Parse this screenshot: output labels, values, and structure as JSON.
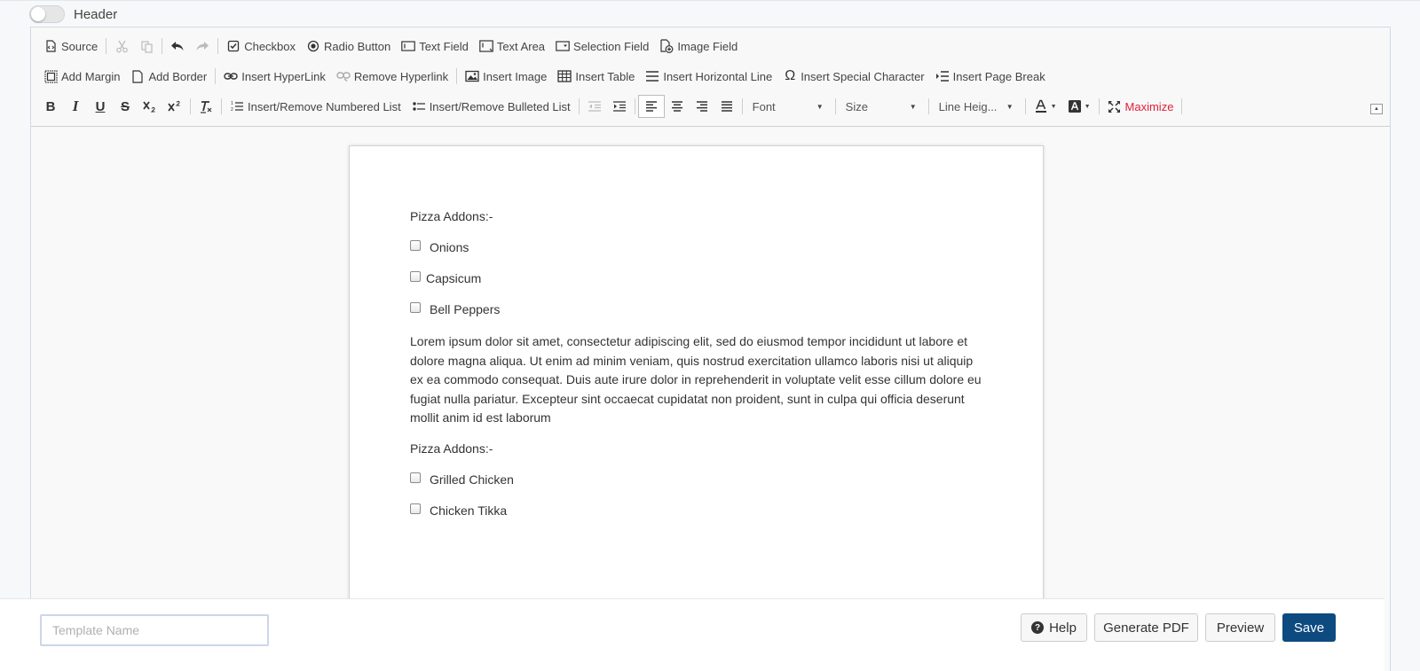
{
  "header": {
    "label": "Header"
  },
  "toolbar": {
    "row1": {
      "source": "Source",
      "checkbox": "Checkbox",
      "radio": "Radio Button",
      "text_field": "Text Field",
      "text_area": "Text Area",
      "selection_field": "Selection Field",
      "image_field": "Image Field"
    },
    "row2": {
      "add_margin": "Add Margin",
      "add_border": "Add Border",
      "insert_hyperlink": "Insert HyperLink",
      "remove_hyperlink": "Remove Hyperlink",
      "insert_image": "Insert Image",
      "insert_table": "Insert Table",
      "insert_hline": "Insert Horizontal Line",
      "insert_special": "Insert Special Character",
      "insert_pagebreak": "Insert Page Break"
    },
    "row3": {
      "bold_glyph": "B",
      "italic_glyph": "I",
      "underline_glyph": "U",
      "strike_glyph": "S",
      "numbered_list": "Insert/Remove Numbered List",
      "bulleted_list": "Insert/Remove Bulleted List",
      "font": "Font",
      "size": "Size",
      "line_height": "Line Heig...",
      "maximize": "Maximize"
    }
  },
  "document": {
    "section1_label": "Pizza Addons:-",
    "section1_items": [
      "Onions",
      "Capsicum",
      "Bell Peppers"
    ],
    "lorem": "Lorem ipsum dolor sit amet, consectetur adipiscing elit, sed do eiusmod tempor incididunt ut labore et dolore magna aliqua. Ut enim ad minim veniam, quis nostrud exercitation ullamco laboris nisi ut aliquip ex ea commodo consequat. Duis aute irure dolor in reprehenderit in voluptate velit esse cillum dolore eu fugiat nulla pariatur. Excepteur sint occaecat cupidatat non proident, sunt in culpa qui officia deserunt mollit anim id est laborum",
    "section2_label": "Pizza Addons:-",
    "section2_items": [
      "Grilled Chicken",
      "Chicken Tikka"
    ]
  },
  "footer": {
    "template_placeholder": "Template Name",
    "help": "Help",
    "generate_pdf": "Generate PDF",
    "preview": "Preview",
    "save": "Save"
  },
  "colors": {
    "save_bg": "#0d4a80",
    "maximize": "#e0203a",
    "editor_border": "#d1d9e6"
  }
}
